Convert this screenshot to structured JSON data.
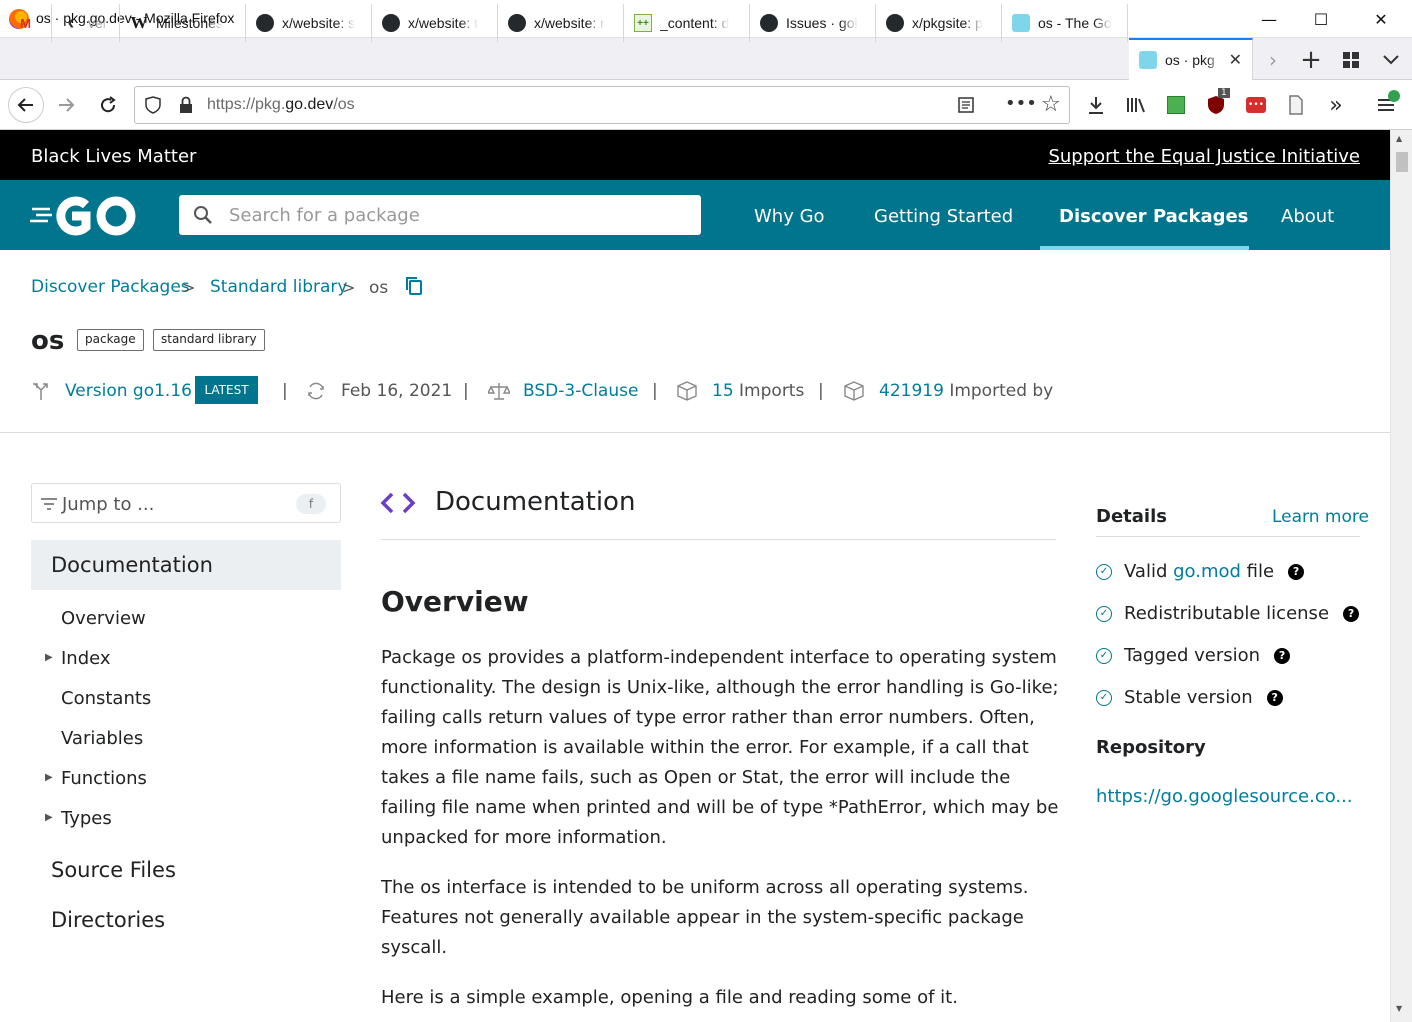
{
  "window": {
    "title": "os · pkg.go.dev - Mozilla Firefox",
    "minimize": "—",
    "maximize": "☐",
    "close": "✕"
  },
  "tabs": [
    {
      "label": "",
      "icon": "gmail-icon"
    },
    {
      "label": "ver",
      "icon": "back-arrow-icon"
    },
    {
      "label": "Milestones",
      "icon": "wikipedia-icon"
    },
    {
      "label": "x/website: s",
      "icon": "github-icon"
    },
    {
      "label": "x/website: t",
      "icon": "github-icon"
    },
    {
      "label": "x/website: r",
      "icon": "github-icon"
    },
    {
      "label": "_content: d",
      "icon": "gerrit-icon"
    },
    {
      "label": "Issues · gol",
      "icon": "github-icon"
    },
    {
      "label": "x/pkgsite: p",
      "icon": "github-icon"
    },
    {
      "label": "os - The Go",
      "icon": "gopher-icon"
    },
    {
      "label": "os · pkg",
      "icon": "gopher-icon"
    }
  ],
  "nav": {
    "url_prefix": "https://pkg.",
    "url_domain": "go.dev",
    "url_path": "/os"
  },
  "banner": {
    "left": "Black Lives Matter",
    "right": "Support the Equal Justice Initiative"
  },
  "header": {
    "search_placeholder": "Search for a package",
    "links": [
      "Why Go",
      "Getting Started",
      "Discover Packages",
      "About"
    ],
    "active_link": "Discover Packages"
  },
  "breadcrumb": {
    "items": [
      "Discover Packages",
      "Standard library",
      "os"
    ],
    "sep": ">"
  },
  "package": {
    "name": "os",
    "chips": [
      "package",
      "standard library"
    ],
    "version": "Version go1.16",
    "latest": "LATEST",
    "date": "Feb 16, 2021",
    "license": "BSD-3-Clause",
    "imports_count": "15",
    "imports_label": "Imports",
    "imported_by_count": "421919",
    "imported_by_label": "Imported by",
    "sep": "|"
  },
  "sidebar": {
    "jump_placeholder": "Jump to ...",
    "jump_key": "f",
    "active": "Documentation",
    "items": [
      "Overview",
      "Index",
      "Constants",
      "Variables",
      "Functions",
      "Types"
    ],
    "sections": [
      "Source Files",
      "Directories"
    ]
  },
  "main": {
    "doc_title": "Documentation",
    "overview_title": "Overview",
    "paragraphs": [
      "Package os provides a platform-independent interface to operating system functionality. The design is Unix-like, although the error handling is Go-like; failing calls return values of type error rather than error numbers. Often, more information is available within the error. For example, if a call that takes a file name fails, such as Open or Stat, the error will include the failing file name when printed and will be of type *PathError, which may be unpacked for more information.",
      "The os interface is intended to be uniform across all operating systems. Features not generally available appear in the system-specific package syscall.",
      "Here is a simple example, opening a file and reading some of it."
    ]
  },
  "details": {
    "title": "Details",
    "learn_more": "Learn more",
    "valid_prefix": "Valid ",
    "valid_link": "go.mod",
    "valid_suffix": " file",
    "items": [
      "Redistributable license",
      "Tagged version",
      "Stable version"
    ],
    "help": "?",
    "repository_title": "Repository",
    "repository_link": "https://go.googlesource.co..."
  },
  "colors": {
    "go_blue": "#00758d",
    "link": "#007d9c",
    "doc_icon": "#6a3ec8"
  }
}
